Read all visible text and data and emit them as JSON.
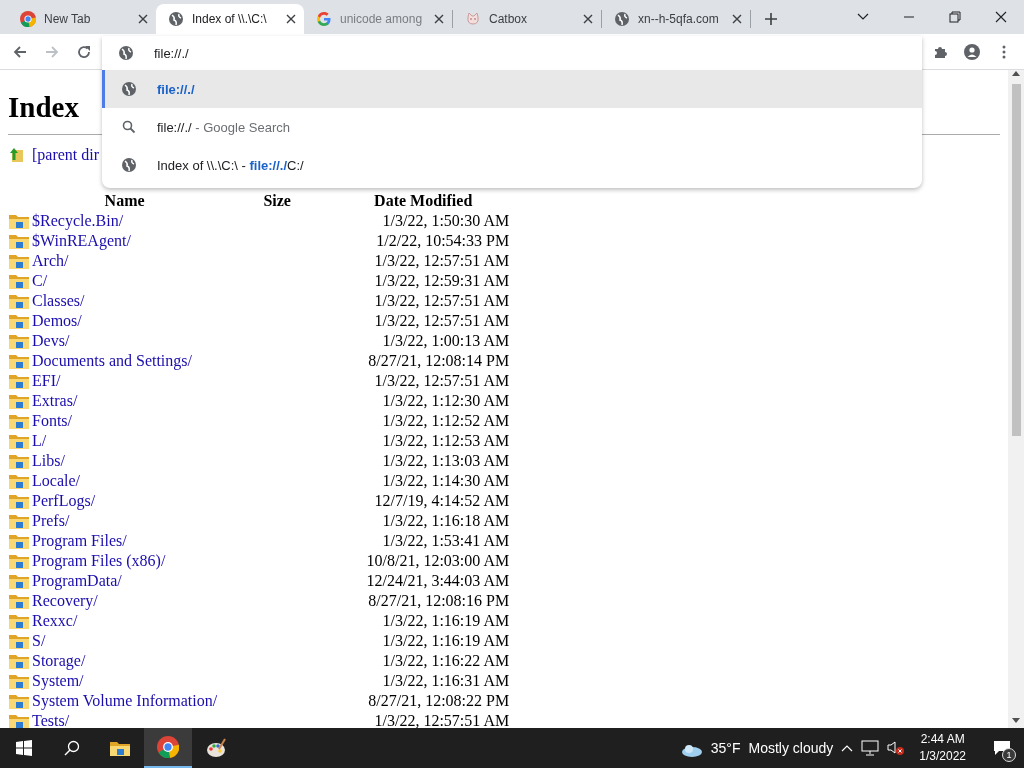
{
  "tabs": [
    {
      "title": "New Tab",
      "kind": "chrome",
      "selected": false,
      "faded": false
    },
    {
      "title": "Index of \\\\.\\C:\\",
      "kind": "globe",
      "selected": true,
      "faded": false
    },
    {
      "title": "unicode among",
      "kind": "google",
      "selected": false,
      "faded": true
    },
    {
      "title": "Catbox",
      "kind": "cat",
      "selected": false,
      "faded": false
    },
    {
      "title": "xn--h-5qfa.com",
      "kind": "globe",
      "selected": false,
      "faded": false
    }
  ],
  "toolbar": {
    "back_disabled": false,
    "forward_disabled": true
  },
  "omnibox": {
    "value": "file://./",
    "suggestions": [
      {
        "kind": "globe",
        "selected": true,
        "parts": [
          {
            "text": "file://./",
            "kind": "match"
          }
        ]
      },
      {
        "kind": "search",
        "selected": false,
        "parts": [
          {
            "text": "file://./",
            "kind": "plain"
          },
          {
            "text": " - Google Search",
            "kind": "dim"
          }
        ]
      },
      {
        "kind": "globe",
        "selected": false,
        "parts": [
          {
            "text": "Index of \\\\.\\C:\\ - ",
            "kind": "plain"
          },
          {
            "text": "file://./",
            "kind": "match"
          },
          {
            "text": "C:/",
            "kind": "plain"
          }
        ]
      }
    ]
  },
  "page": {
    "heading": "Index",
    "parent_link": "[parent dir",
    "columns": [
      "Name",
      "Size",
      "Date Modified"
    ],
    "rows": [
      {
        "name": "$Recycle.Bin/",
        "modified": "1/3/22, 1:50:30 AM"
      },
      {
        "name": "$WinREAgent/",
        "modified": "1/2/22, 10:54:33 PM"
      },
      {
        "name": "Arch/",
        "modified": "1/3/22, 12:57:51 AM"
      },
      {
        "name": "C/",
        "modified": "1/3/22, 12:59:31 AM"
      },
      {
        "name": "Classes/",
        "modified": "1/3/22, 12:57:51 AM"
      },
      {
        "name": "Demos/",
        "modified": "1/3/22, 12:57:51 AM"
      },
      {
        "name": "Devs/",
        "modified": "1/3/22, 1:00:13 AM"
      },
      {
        "name": "Documents and Settings/",
        "modified": "8/27/21, 12:08:14 PM"
      },
      {
        "name": "EFI/",
        "modified": "1/3/22, 12:57:51 AM"
      },
      {
        "name": "Extras/",
        "modified": "1/3/22, 1:12:30 AM"
      },
      {
        "name": "Fonts/",
        "modified": "1/3/22, 1:12:52 AM"
      },
      {
        "name": "L/",
        "modified": "1/3/22, 1:12:53 AM"
      },
      {
        "name": "Libs/",
        "modified": "1/3/22, 1:13:03 AM"
      },
      {
        "name": "Locale/",
        "modified": "1/3/22, 1:14:30 AM"
      },
      {
        "name": "PerfLogs/",
        "modified": "12/7/19, 4:14:52 AM"
      },
      {
        "name": "Prefs/",
        "modified": "1/3/22, 1:16:18 AM"
      },
      {
        "name": "Program Files/",
        "modified": "1/3/22, 1:53:41 AM"
      },
      {
        "name": "Program Files (x86)/",
        "modified": "10/8/21, 12:03:00 AM"
      },
      {
        "name": "ProgramData/",
        "modified": "12/24/21, 3:44:03 AM"
      },
      {
        "name": "Recovery/",
        "modified": "8/27/21, 12:08:16 PM"
      },
      {
        "name": "Rexxc/",
        "modified": "1/3/22, 1:16:19 AM"
      },
      {
        "name": "S/",
        "modified": "1/3/22, 1:16:19 AM"
      },
      {
        "name": "Storage/",
        "modified": "1/3/22, 1:16:22 AM"
      },
      {
        "name": "System/",
        "modified": "1/3/22, 1:16:31 AM"
      },
      {
        "name": "System Volume Information/",
        "modified": "8/27/21, 12:08:22 PM"
      },
      {
        "name": "Tests/",
        "modified": "1/3/22, 12:57:51 AM"
      }
    ]
  },
  "taskbar": {
    "apps": [
      {
        "kind": "folder",
        "active": false
      },
      {
        "kind": "chrome",
        "active": true
      },
      {
        "kind": "paint",
        "active": false
      }
    ],
    "temperature": "35°F",
    "weather": "Mostly cloudy",
    "time": "2:44 AM",
    "date": "1/3/2022",
    "notifications": "1"
  }
}
